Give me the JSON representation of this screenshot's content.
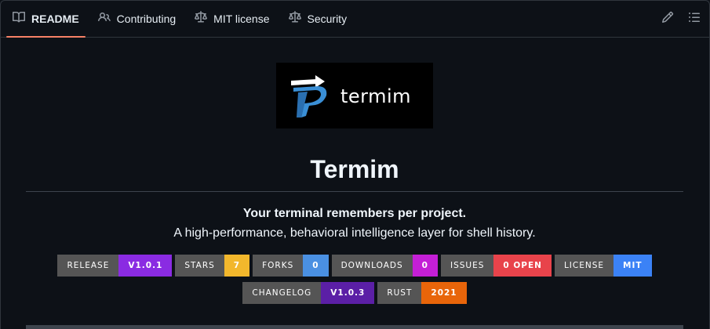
{
  "tabs": [
    {
      "label": "README",
      "icon": "book-icon",
      "active": true
    },
    {
      "label": "Contributing",
      "icon": "people-icon",
      "active": false
    },
    {
      "label": "MIT license",
      "icon": "law-icon",
      "active": false
    },
    {
      "label": "Security",
      "icon": "law-icon",
      "active": false
    }
  ],
  "actions": {
    "edit_icon": "pencil-icon",
    "outline_icon": "list-unordered-icon"
  },
  "logo": {
    "text": "termim"
  },
  "readme": {
    "title": "Termim",
    "tagline": "Your terminal remembers per project.",
    "subline": "A high-performance, behavioral intelligence layer for shell history."
  },
  "badges_row1": [
    {
      "key": "RELEASE",
      "value": "V1.0.1",
      "color": "#8a2be2"
    },
    {
      "key": "STARS",
      "value": "7",
      "color": "#f2b72c"
    },
    {
      "key": "FORKS",
      "value": "0",
      "color": "#4a90e2"
    },
    {
      "key": "DOWNLOADS",
      "value": "0",
      "color": "#c41fd6"
    },
    {
      "key": "ISSUES",
      "value": "0 OPEN",
      "color": "#e8434b"
    },
    {
      "key": "LICENSE",
      "value": "MIT",
      "color": "#3b82f6"
    }
  ],
  "badges_row2": [
    {
      "key": "CHANGELOG",
      "value": "V1.0.3",
      "color": "#5b1fa6"
    },
    {
      "key": "RUST",
      "value": "2021",
      "color": "#e8650a"
    }
  ],
  "colors": {
    "background": "#0d1117",
    "active_tab_underline": "#f78166",
    "border": "#30363d"
  }
}
